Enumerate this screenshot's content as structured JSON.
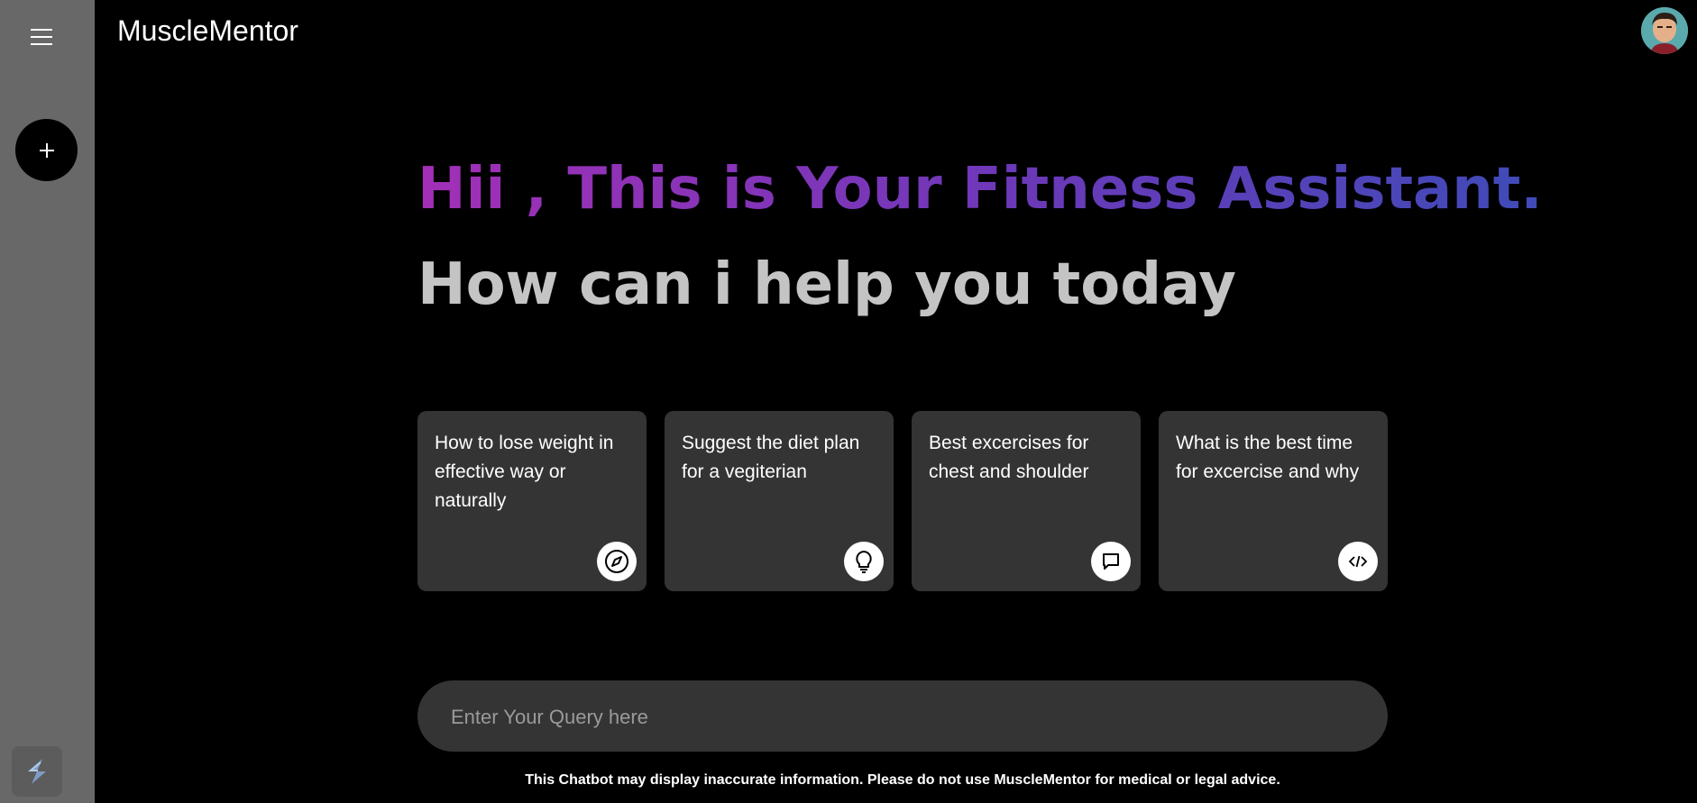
{
  "header": {
    "app_title": "MuscleMentor",
    "avatar_icon": "user-avatar"
  },
  "sidebar": {
    "menu_icon": "hamburger-menu-icon",
    "new_chat_label": "+",
    "badge_icon": "app-logo-icon"
  },
  "main": {
    "greeting": "Hii , This is Your Fitness Assistant.",
    "subgreeting": "How can i help you today",
    "cards": [
      {
        "text": "How to lose weight in effective way or naturally",
        "icon": "compass-icon"
      },
      {
        "text": "Suggest the diet plan for a vegiterian",
        "icon": "lightbulb-icon"
      },
      {
        "text": "Best excercises for chest and shoulder",
        "icon": "chat-bubble-icon"
      },
      {
        "text": "What is the best time for excercise and why",
        "icon": "code-icon"
      }
    ],
    "query": {
      "placeholder": "Enter Your Query here",
      "value": ""
    },
    "disclaimer": "This Chatbot may display inaccurate information. Please do not use MuscleMentor for medical or legal advice."
  },
  "colors": {
    "sidebar_bg": "#686868",
    "page_bg": "#000000",
    "card_bg": "#343434",
    "gradient_start": "#a22fb7",
    "gradient_end": "#3f4bb8",
    "subgreeting": "#c4c4c4"
  }
}
